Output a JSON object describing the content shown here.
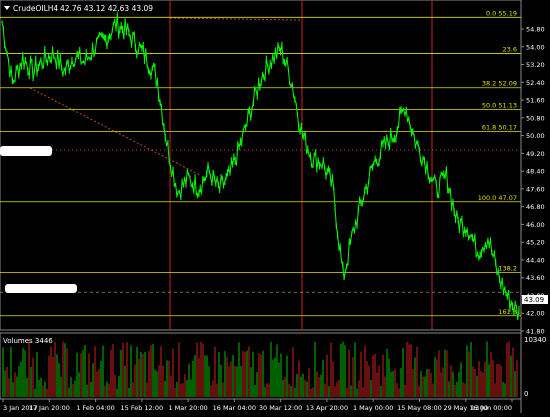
{
  "header": {
    "symbol_label": "CrudeOILH4",
    "ohlc": "42.76 43.12 42.63 43.09"
  },
  "volume_panel": {
    "label": "Volumes 3446",
    "max_label": "10340",
    "zero_label": "0"
  },
  "price_axis": {
    "ticks": [
      "54.80",
      "54.00",
      "53.20",
      "52.40",
      "51.60",
      "50.80",
      "50.00",
      "49.20",
      "48.40",
      "47.60",
      "46.80",
      "46.00",
      "45.20",
      "44.40",
      "43.60",
      "42.80",
      "42.00",
      "41.80"
    ],
    "current_price": "43.09"
  },
  "fib_levels": [
    {
      "label": "0.0 55.19",
      "price": 55.19
    },
    {
      "label": "23.6",
      "price": 53.6
    },
    {
      "label": "38.2 52.09",
      "price": 52.09
    },
    {
      "label": "50.0 51.13",
      "price": 51.13
    },
    {
      "label": "61.8 50.17",
      "price": 50.17
    },
    {
      "label": "100.0 47.07",
      "price": 47.07
    },
    {
      "label": "138.2",
      "price": 43.95
    },
    {
      "label": "161.8",
      "price": 42.05
    }
  ],
  "time_axis": {
    "labels": [
      "3 Jan 2017",
      "17 Jan 20:00",
      "1 Feb 04:00",
      "15 Feb 12:00",
      "1 Mar 20:00",
      "16 Mar 04:00",
      "30 Mar 12:00",
      "13 Apr 20:00",
      "1 May 00:00",
      "15 May 08:00",
      "29 May 16:00",
      "13 Jun 00:00"
    ]
  },
  "colors": {
    "background": "#000000",
    "price_line": "#00ff00",
    "fib_line": "#e0e000",
    "fib_text": "#e0e000",
    "vertical_marker": "#cc2222",
    "volume_green": "#00c000",
    "volume_red": "#cc2020",
    "axis_text": "#ffffff",
    "grid": "#444444"
  },
  "chart_data": {
    "type": "line",
    "title": "CrudeOILH4",
    "ylim": [
      41.6,
      55.6
    ],
    "x": [
      "3 Jan 2017",
      "17 Jan 20:00",
      "1 Feb 04:00",
      "15 Feb 12:00",
      "1 Mar 20:00",
      "16 Mar 04:00",
      "30 Mar 12:00",
      "13 Apr 20:00",
      "1 May 00:00",
      "15 May 08:00",
      "29 May 16:00",
      "13 Jun 00:00"
    ],
    "series": [
      {
        "values": [
          55.0,
          52.3,
          53.4,
          52.8,
          53.3,
          53.6,
          52.8,
          53.5,
          53.2,
          53.9,
          54.2,
          54.9,
          54.6,
          54.0,
          53.4,
          52.5,
          49.5,
          47.5,
          48.1,
          47.7,
          48.4,
          47.6,
          48.2,
          49.5,
          51.0,
          52.5,
          53.3,
          53.8,
          52.4,
          50.1,
          49.0,
          48.8,
          47.7,
          43.7,
          45.8,
          47.4,
          48.8,
          49.5,
          50.1,
          51.3,
          49.7,
          48.8,
          47.6,
          48.2,
          46.2,
          46.0,
          44.9,
          45.5,
          43.8,
          42.8,
          42.1
        ]
      }
    ]
  }
}
